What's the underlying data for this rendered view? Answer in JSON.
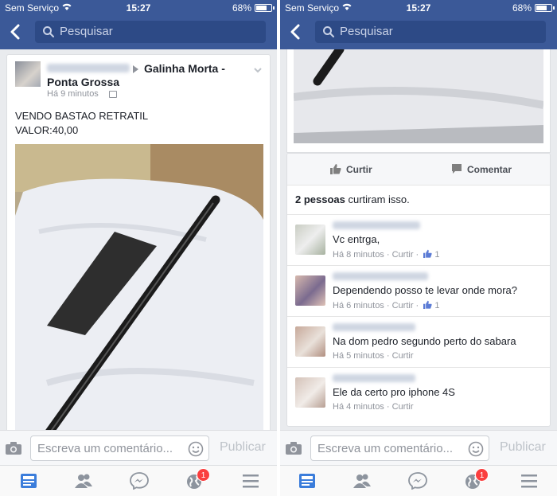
{
  "status": {
    "carrier": "Sem Serviço",
    "time": "15:27",
    "battery": "68%"
  },
  "nav": {
    "search_placeholder": "Pesquisar"
  },
  "post": {
    "group_line1": "Galinha Morta -",
    "group_line2": "Ponta Grossa",
    "time": "Há 9 minutos",
    "text_line1": "VENDO BASTAO RETRATIL",
    "text_line2": "VALOR:40,00"
  },
  "actions": {
    "like": "Curtir",
    "comment": "Comentar"
  },
  "likes": {
    "count": "2 pessoas",
    "suffix": " curtiram isso."
  },
  "comments": [
    {
      "text": "Vc entrga,",
      "time": "Há 8 minutos",
      "like": "Curtir",
      "likes": "1"
    },
    {
      "text": "Dependendo posso te levar onde mora?",
      "time": "Há 6 minutos",
      "like": "Curtir",
      "likes": "1"
    },
    {
      "text": "Na dom pedro segundo perto do sabara",
      "time": "Há 5 minutos",
      "like": "Curtir",
      "likes": ""
    },
    {
      "text": "Ele da certo pro iphone 4S",
      "time": "Há 4 minutos",
      "like": "Curtir",
      "likes": ""
    }
  ],
  "composer": {
    "placeholder": "Escreva um comentário...",
    "publish": "Publicar"
  },
  "tabs": {
    "notifications_badge": "1"
  },
  "colors": {
    "brand": "#3b5998",
    "badge": "#fa3e3e"
  },
  "icons": [
    "back-arrow-icon",
    "search-icon",
    "camera-icon",
    "smiley-icon",
    "news-feed-icon",
    "friends-icon",
    "messenger-icon",
    "globe-icon",
    "menu-icon",
    "thumb-up-icon",
    "comment-icon"
  ]
}
